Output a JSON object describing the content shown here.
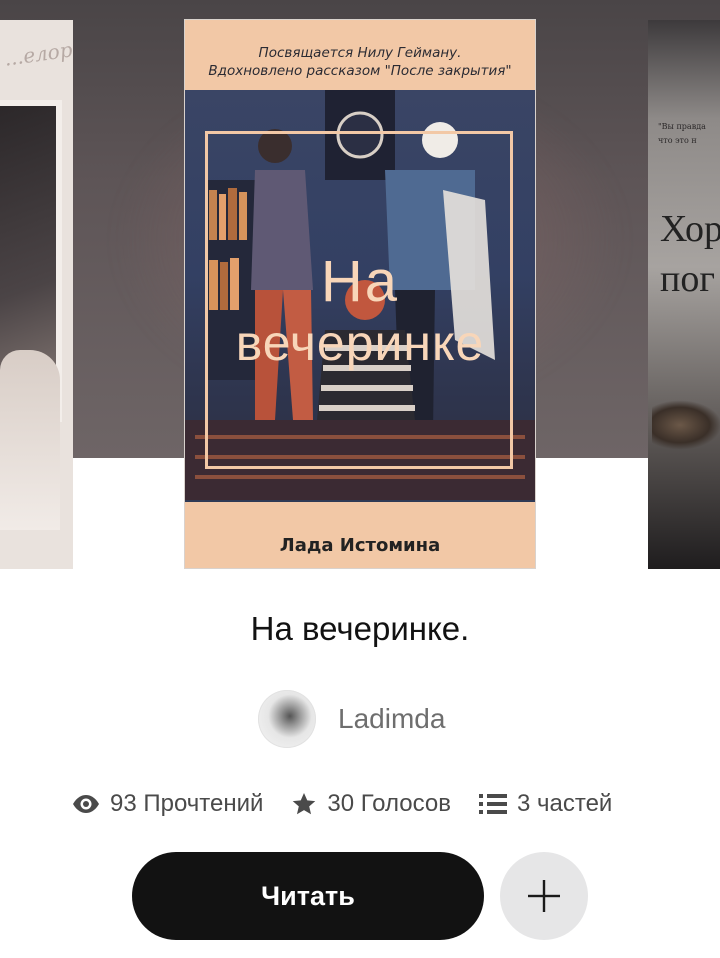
{
  "carousel": {
    "left_cover_script": "...елорь",
    "main_cover": {
      "dedication_line1": "Посвящается Нилу Гейману.",
      "dedication_line2": "Вдохновлено рассказом \"После закрытия\"",
      "title_line1": "На",
      "title_line2": "вечеринке",
      "author": "Лада Истомина",
      "colors": {
        "band": "#f2c8a6",
        "background": "#2f3a55",
        "title_text": "#f8d6b9"
      }
    },
    "right_cover": {
      "quote_line1": "\"Вы правда",
      "quote_line2": "что это н",
      "title_line1": "Хор",
      "title_line2": "пог"
    }
  },
  "story": {
    "title": "На вечеринке.",
    "author_username": "Ladimda"
  },
  "stats": {
    "reads": "93 Прочтений",
    "votes": "30 Голосов",
    "parts": "3 частей"
  },
  "actions": {
    "read_label": "Читать",
    "add_icon": "plus-icon"
  },
  "colors": {
    "primary_button": "#121212",
    "secondary_button": "#e6e6e7",
    "text_muted": "#6e6e6e"
  }
}
